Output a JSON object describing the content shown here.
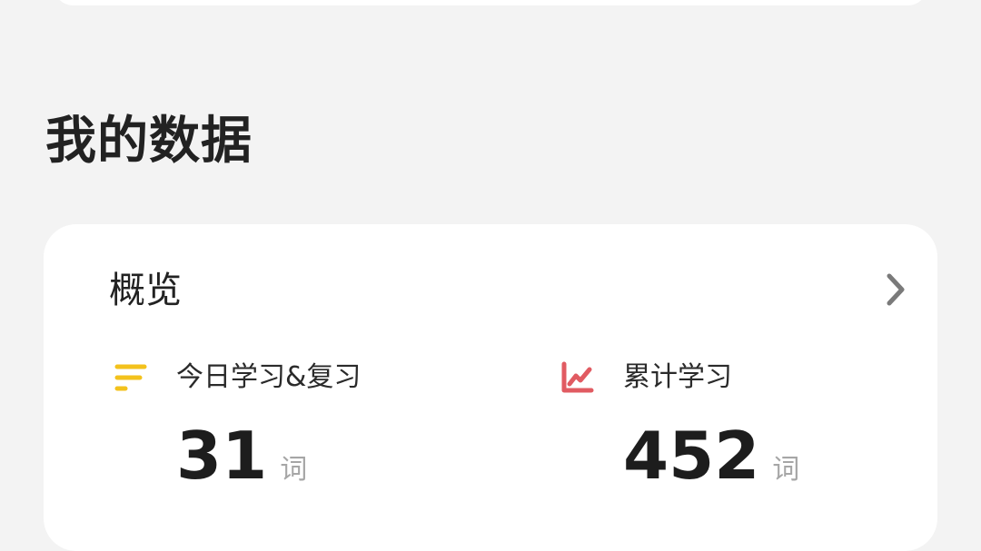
{
  "section": {
    "title": "我的数据"
  },
  "overview": {
    "title": "概览",
    "stats": [
      {
        "label": "今日学习&复习",
        "value": "31",
        "unit": "词",
        "icon": "bars-icon",
        "color": "#f3c21c"
      },
      {
        "label": "累计学习",
        "value": "452",
        "unit": "词",
        "icon": "trend-chart-icon",
        "color": "#e15b62"
      }
    ]
  },
  "colors": {
    "background": "#f3f3f3",
    "card": "#ffffff",
    "chevron": "#7a7a7a"
  }
}
